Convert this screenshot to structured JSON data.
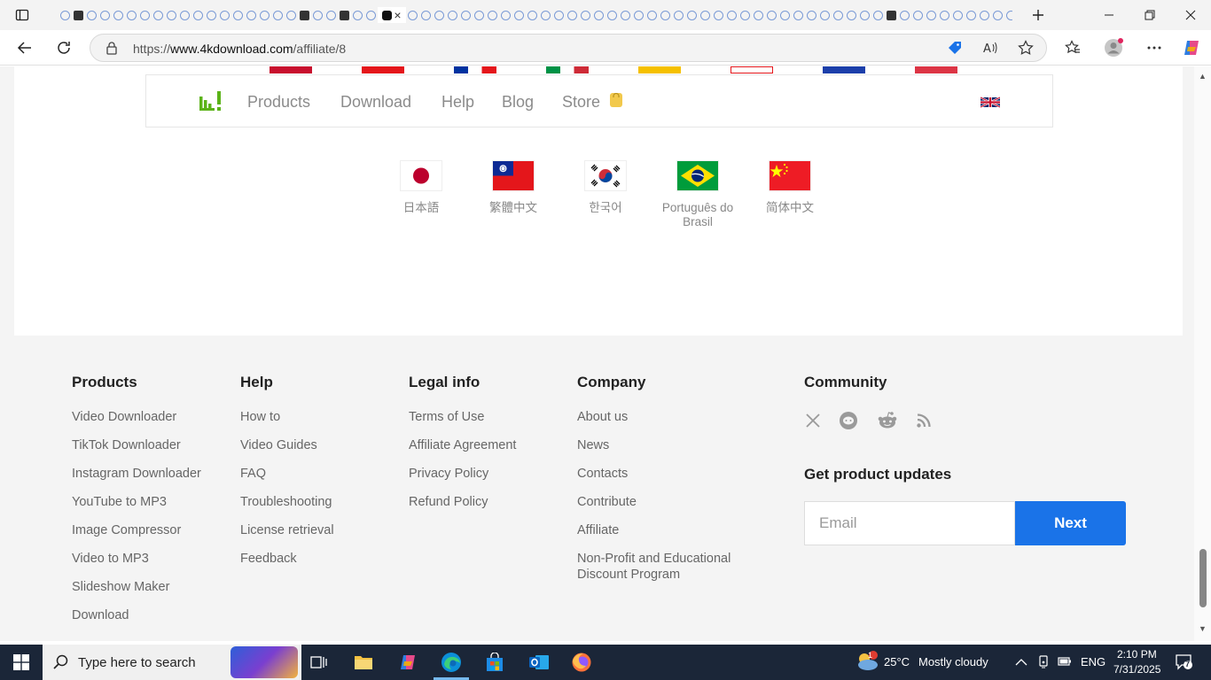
{
  "browser": {
    "url_prefix": "https://",
    "url_domain": "www.4kdownload.com",
    "url_path": "/affiliate/8"
  },
  "site_nav": {
    "links": [
      "Products",
      "Download",
      "Help",
      "Blog",
      "Store"
    ]
  },
  "languages": [
    {
      "name": "日本語",
      "flag": "japan"
    },
    {
      "name": "繁體中文",
      "flag": "taiwan"
    },
    {
      "name": "한국어",
      "flag": "korea"
    },
    {
      "name": "Português do Brasil",
      "flag": "brazil"
    },
    {
      "name": "简体中文",
      "flag": "china"
    }
  ],
  "footer": {
    "products": {
      "title": "Products",
      "links": [
        "Video Downloader",
        "TikTok Downloader",
        "Instagram Downloader",
        "YouTube to MP3",
        "Image Compressor",
        "Video to MP3",
        "Slideshow Maker",
        "Download"
      ]
    },
    "help": {
      "title": "Help",
      "links": [
        "How to",
        "Video Guides",
        "FAQ",
        "Troubleshooting",
        "License retrieval",
        "Feedback"
      ]
    },
    "legal": {
      "title": "Legal info",
      "links": [
        "Terms of Use",
        "Affiliate Agreement",
        "Privacy Policy",
        "Refund Policy"
      ]
    },
    "company": {
      "title": "Company",
      "links": [
        "About us",
        "News",
        "Contacts",
        "Contribute",
        "Affiliate",
        "Non-Profit and Educational Discount Program"
      ]
    },
    "community": {
      "title": "Community",
      "icons": [
        "x-icon",
        "chat-icon",
        "reddit-icon",
        "rss-icon"
      ]
    },
    "updates": {
      "title": "Get product updates",
      "email_placeholder": "Email",
      "next_label": "Next"
    }
  },
  "taskbar": {
    "search_placeholder": "Type here to search",
    "weather_temp": "25°C",
    "weather_text": "Mostly cloudy",
    "language": "ENG",
    "time": "2:10 PM",
    "date": "7/31/2025",
    "notification_count": "7",
    "weather_badge": "1"
  },
  "colors": {
    "accent": "#1a73e8",
    "logo_green": "#5bb318",
    "taskbar": "#1b2638"
  }
}
